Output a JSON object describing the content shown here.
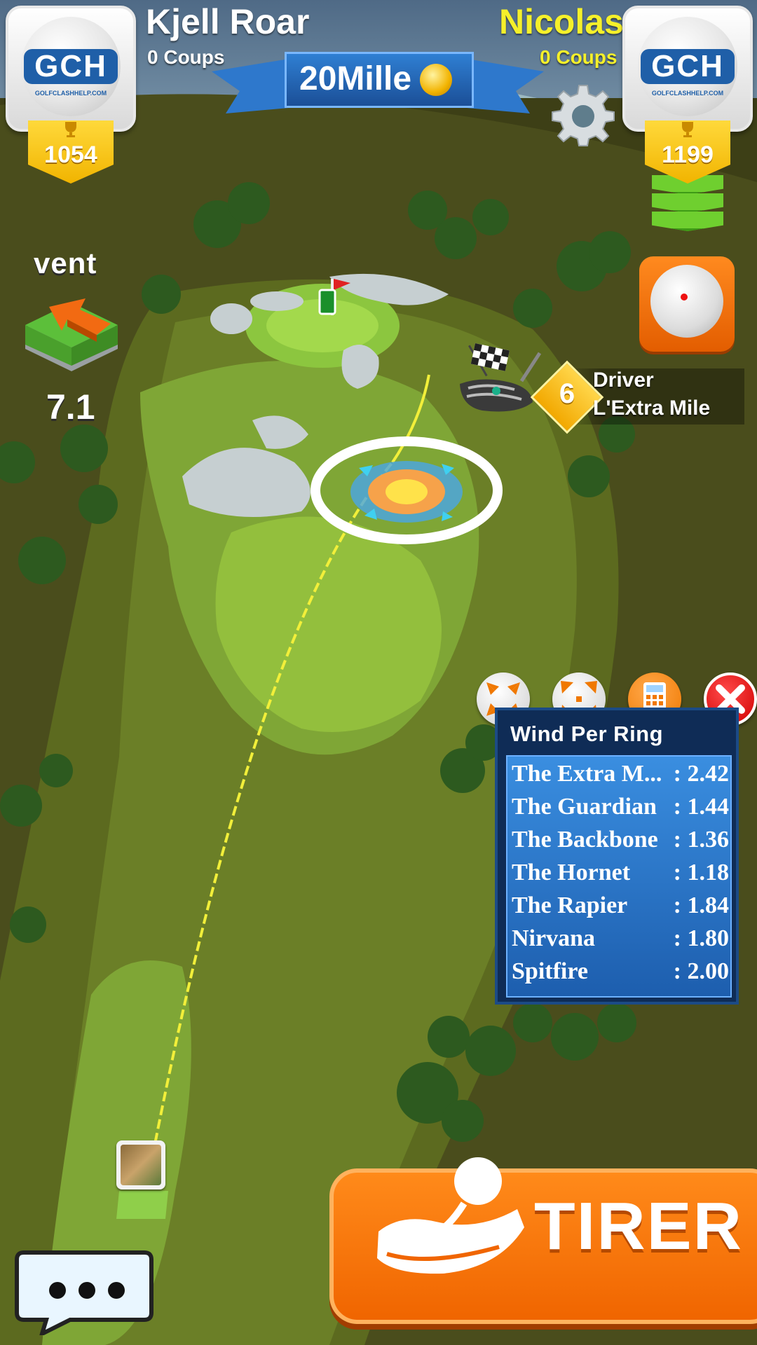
{
  "players": {
    "left": {
      "name": "Kjell Roar",
      "shots": "0 Coups",
      "trophies": "1054",
      "logo": "GCH",
      "logo_url": "GOLFCLASHHELP.COM"
    },
    "right": {
      "name": "Nicolas",
      "shots": "0 Coups",
      "trophies": "1199",
      "logo": "GCH",
      "logo_url": "GOLFCLASHHELP.COM"
    }
  },
  "match": {
    "stake": "20Mille",
    "stake_icon": "gold-coin-crown-icon"
  },
  "wind": {
    "label": "vent",
    "value": "7.1"
  },
  "club": {
    "level": "6",
    "type": "Driver",
    "name": "L'Extra Mile"
  },
  "calculator": {
    "title": "Wind Per Ring",
    "rows": [
      {
        "name": "The Extra M...",
        "value": ": 2.42"
      },
      {
        "name": "The Guardian",
        "value": ": 1.44"
      },
      {
        "name": "The Backbone",
        "value": ": 1.36"
      },
      {
        "name": "The Hornet",
        "value": ": 1.18"
      },
      {
        "name": "The Rapier",
        "value": ": 1.84"
      },
      {
        "name": "Nirvana",
        "value": ": 1.80"
      },
      {
        "name": "Spitfire",
        "value": ": 2.00"
      }
    ]
  },
  "actions": {
    "shoot": "TIRER"
  },
  "colors": {
    "accent_orange": "#f07800",
    "panel_blue": "#0f2c56",
    "right_player_yellow": "#f5f02a",
    "trophy_gold": "#f1b400",
    "close_red": "#d10000"
  }
}
